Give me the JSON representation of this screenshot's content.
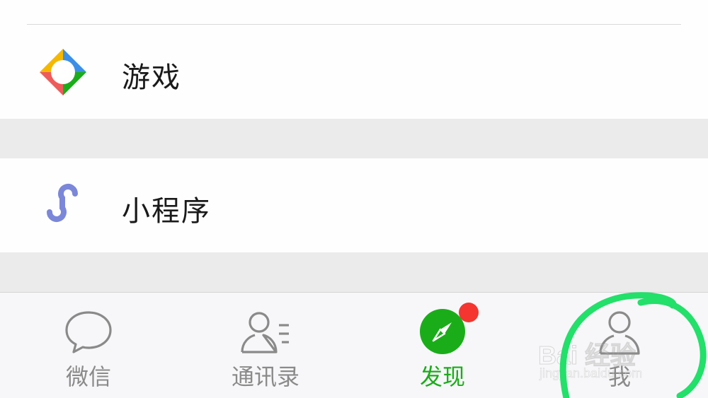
{
  "list": {
    "games_label": "游戏",
    "mini_programs_label": "小程序"
  },
  "tabbar": {
    "tabs": [
      {
        "label": "微信",
        "icon": "chat-bubble-icon",
        "active": false
      },
      {
        "label": "通讯录",
        "icon": "contacts-icon",
        "active": false
      },
      {
        "label": "发现",
        "icon": "compass-icon",
        "active": true
      },
      {
        "label": "我",
        "icon": "person-icon",
        "active": false
      }
    ],
    "active_color": "#1aad19",
    "inactive_color": "#8a8a8a",
    "badge_color": "#f43530"
  },
  "watermark": {
    "brand": "Bai 经验",
    "url": "jingyan.baidu.com"
  },
  "annotation_color": "#22e06a"
}
